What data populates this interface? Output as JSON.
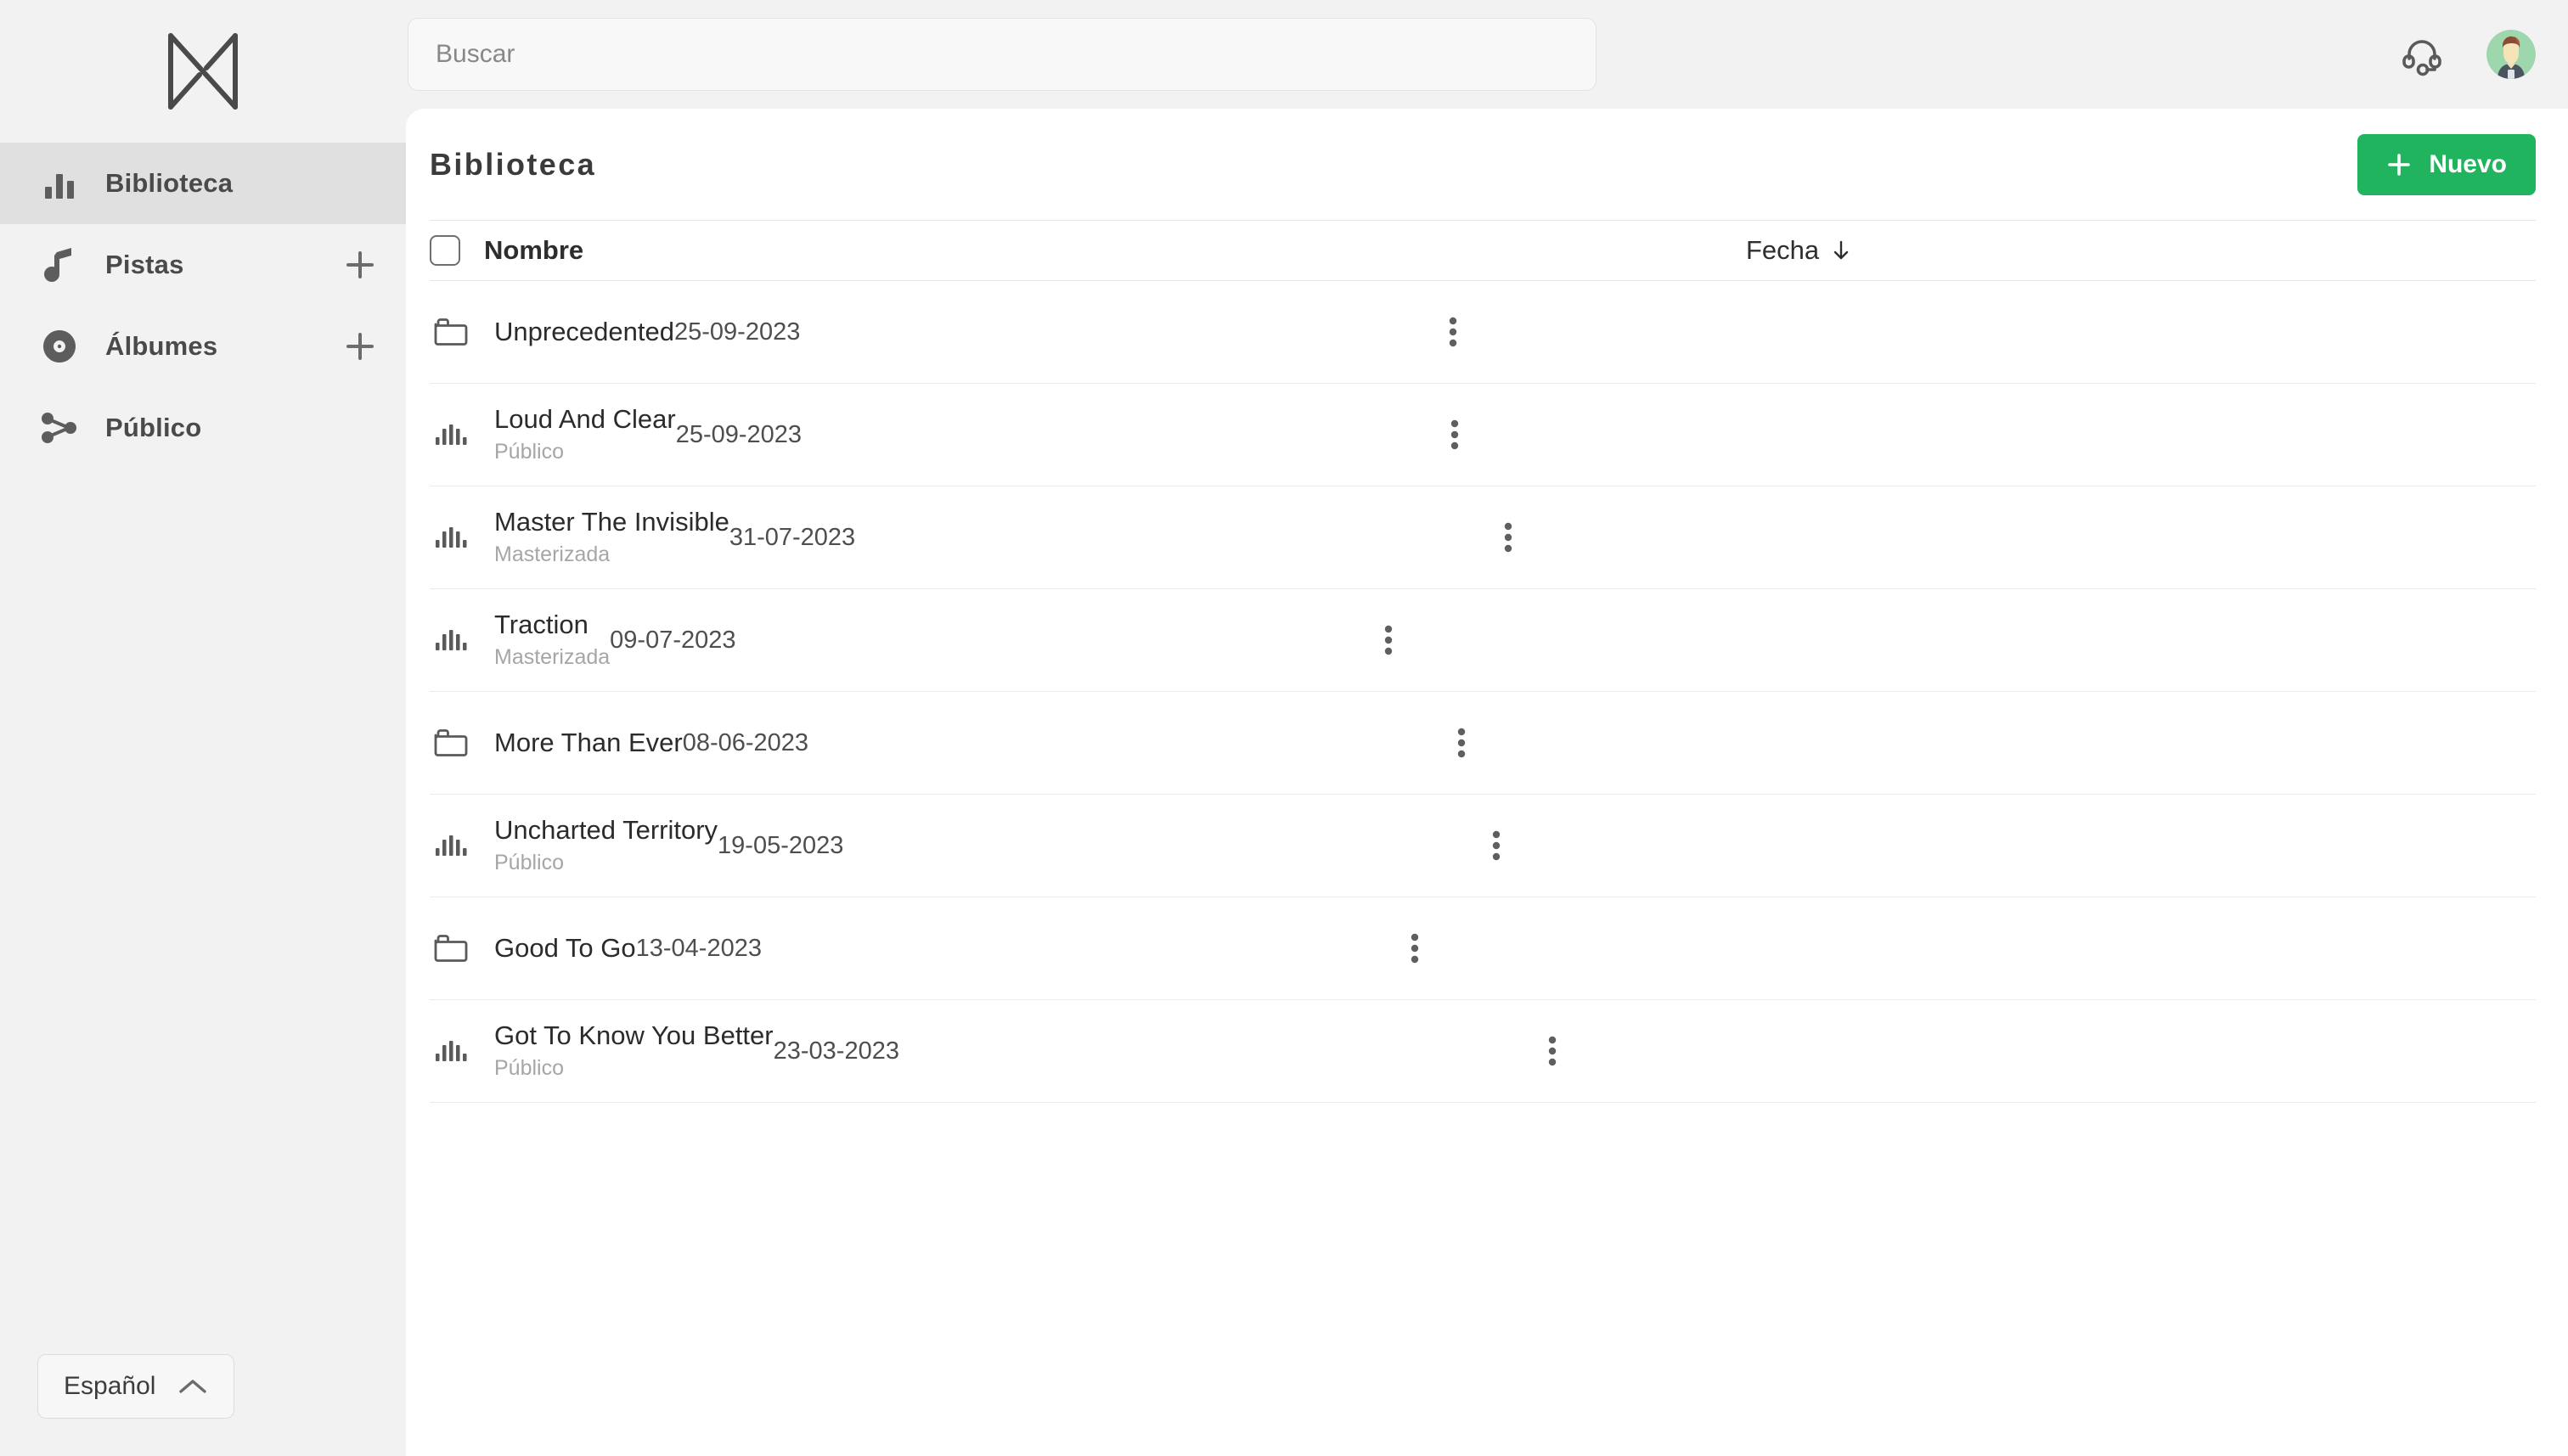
{
  "brand": {
    "logo_icon": "landr-logo-icon"
  },
  "sidebar": {
    "items": [
      {
        "label": "Biblioteca",
        "icon": "bar-chart-icon",
        "active": true,
        "has_add": false
      },
      {
        "label": "Pistas",
        "icon": "music-note-icon",
        "active": false,
        "has_add": true
      },
      {
        "label": "Álbumes",
        "icon": "vinyl-record-icon",
        "active": false,
        "has_add": true
      },
      {
        "label": "Público",
        "icon": "share-icon",
        "active": false,
        "has_add": false
      }
    ],
    "language": {
      "label": "Español",
      "chevron": "chevron-up-icon"
    }
  },
  "topbar": {
    "search": {
      "value": "",
      "placeholder": "Buscar",
      "icon": "search-icon"
    },
    "support_icon": "headset-icon",
    "avatar": "user-avatar"
  },
  "main": {
    "title": "Biblioteca",
    "new_button": {
      "label": "Nuevo",
      "icon": "plus-icon",
      "color": "#21b45e"
    },
    "table": {
      "select_all_checked": false,
      "columns": {
        "name": "Nombre",
        "date": "Fecha"
      },
      "sort": {
        "column": "Fecha",
        "direction": "desc",
        "icon": "arrow-down-icon"
      },
      "rows": [
        {
          "name": "Unprecedented",
          "subtitle": "",
          "date": "25-09-2023",
          "icon": "folder-icon"
        },
        {
          "name": "Loud And Clear",
          "subtitle": "Público",
          "date": "25-09-2023",
          "icon": "waveform-icon"
        },
        {
          "name": "Master The Invisible",
          "subtitle": "Masterizada",
          "date": "31-07-2023",
          "icon": "waveform-icon"
        },
        {
          "name": "Traction",
          "subtitle": "Masterizada",
          "date": "09-07-2023",
          "icon": "waveform-icon"
        },
        {
          "name": "More Than Ever",
          "subtitle": "",
          "date": "08-06-2023",
          "icon": "folder-icon"
        },
        {
          "name": "Uncharted Territory",
          "subtitle": "Público",
          "date": "19-05-2023",
          "icon": "waveform-icon"
        },
        {
          "name": "Good To Go",
          "subtitle": "",
          "date": "13-04-2023",
          "icon": "folder-icon"
        },
        {
          "name": "Got To Know You Better",
          "subtitle": "Público",
          "date": "23-03-2023",
          "icon": "waveform-icon"
        }
      ],
      "row_menu_icon": "kebab-menu-icon"
    }
  },
  "colors": {
    "accent": "#21b45e",
    "sidebar_bg": "#f2f2f2",
    "active_item": "#e0e0e0",
    "card_bg": "#ffffff"
  }
}
